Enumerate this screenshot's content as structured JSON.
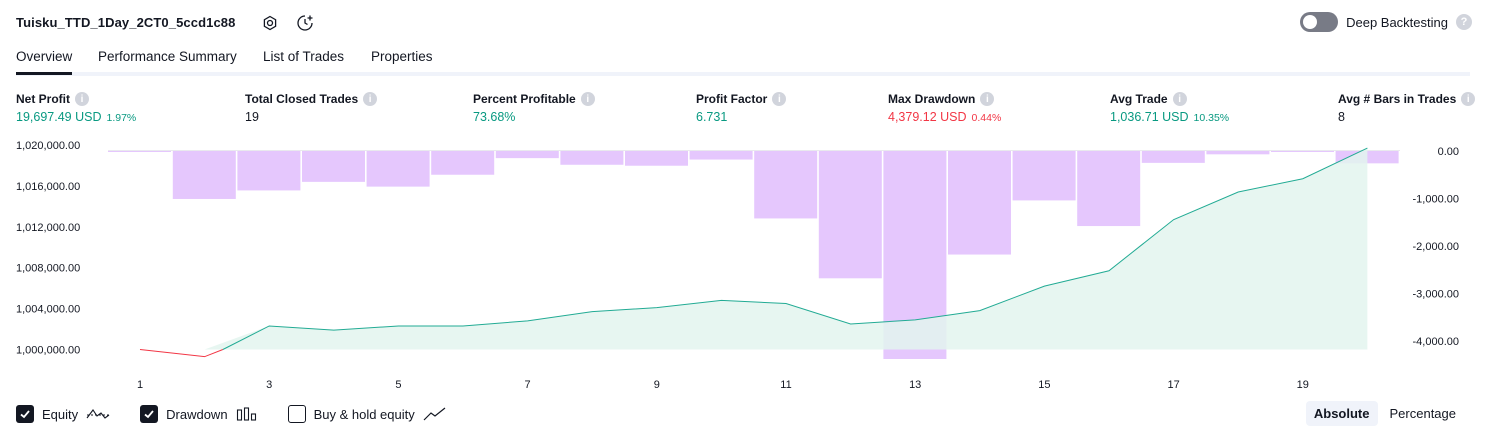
{
  "header": {
    "strategy_name": "Tuisku_TTD_1Day_2CT0_5ccd1c88",
    "settings_icon": "settings-icon",
    "replay_icon": "add-alert-icon",
    "deep_backtesting_label": "Deep Backtesting",
    "deep_backtesting_enabled": false
  },
  "tabs": [
    {
      "label": "Overview",
      "active": true
    },
    {
      "label": "Performance Summary",
      "active": false
    },
    {
      "label": "List of Trades",
      "active": false
    },
    {
      "label": "Properties",
      "active": false
    }
  ],
  "stats": [
    {
      "label": "Net Profit",
      "value": "19,697.49 USD",
      "pct": "1.97%",
      "color": "#089981"
    },
    {
      "label": "Total Closed Trades",
      "value": "19",
      "pct": "",
      "color": "#131722"
    },
    {
      "label": "Percent Profitable",
      "value": "73.68%",
      "pct": "",
      "color": "#089981"
    },
    {
      "label": "Profit Factor",
      "value": "6.731",
      "pct": "",
      "color": "#089981"
    },
    {
      "label": "Max Drawdown",
      "value": "4,379.12 USD",
      "pct": "0.44%",
      "color": "#f23645"
    },
    {
      "label": "Avg Trade",
      "value": "1,036.71 USD",
      "pct": "10.35%",
      "color": "#089981"
    },
    {
      "label": "Avg # Bars in Trades",
      "value": "8",
      "pct": "",
      "color": "#131722"
    }
  ],
  "chart_data": {
    "type": "line+bar",
    "x_ticks": [
      "1",
      "3",
      "5",
      "7",
      "9",
      "11",
      "13",
      "15",
      "17",
      "19"
    ],
    "left_axis": {
      "ticks": [
        "1,020,000.00",
        "1,016,000.00",
        "1,012,000.00",
        "1,008,000.00",
        "1,004,000.00",
        "1,000,000.00"
      ],
      "range": [
        999000,
        1020000
      ]
    },
    "right_axis": {
      "ticks": [
        "0.00",
        "-1,000.00",
        "-2,000.00",
        "-3,000.00",
        "-4,000.00"
      ],
      "range": [
        -4379,
        0
      ]
    },
    "equity": {
      "name": "Equity",
      "x": [
        1,
        2,
        3,
        4,
        5,
        6,
        7,
        8,
        9,
        10,
        11,
        12,
        13,
        14,
        15,
        16,
        17,
        18,
        19,
        20
      ],
      "values": [
        1000000,
        999300,
        1002300,
        1001900,
        1002300,
        1002300,
        1002800,
        1003700,
        1004100,
        1004800,
        1004500,
        1002500,
        1002900,
        1003800,
        1006200,
        1007700,
        1012700,
        1015400,
        1016700,
        1019697
      ]
    },
    "drawdown": {
      "name": "Drawdown",
      "x": [
        1,
        2,
        3,
        4,
        5,
        6,
        7,
        8,
        9,
        10,
        11,
        12,
        13,
        14,
        15,
        16,
        17,
        18,
        19,
        20
      ],
      "values": [
        -10,
        -1010,
        -830,
        -650,
        -750,
        -500,
        -150,
        -290,
        -310,
        -180,
        -1420,
        -2680,
        -4379,
        -2180,
        -1040,
        -1580,
        -250,
        -70,
        -10,
        -260
      ]
    },
    "colors": {
      "equity_up": "#22ab94",
      "equity_down": "#f23645",
      "equity_fill": "#e3f4ef",
      "drawdown": "#e1bdfd"
    }
  },
  "legend": [
    {
      "label": "Equity",
      "checked": true,
      "icon": "equity-line-icon"
    },
    {
      "label": "Drawdown",
      "checked": true,
      "icon": "drawdown-bars-icon"
    },
    {
      "label": "Buy & hold equity",
      "checked": false,
      "icon": "buy-hold-line-icon"
    }
  ],
  "mode": {
    "absolute_label": "Absolute",
    "percentage_label": "Percentage",
    "selected": "Absolute"
  }
}
